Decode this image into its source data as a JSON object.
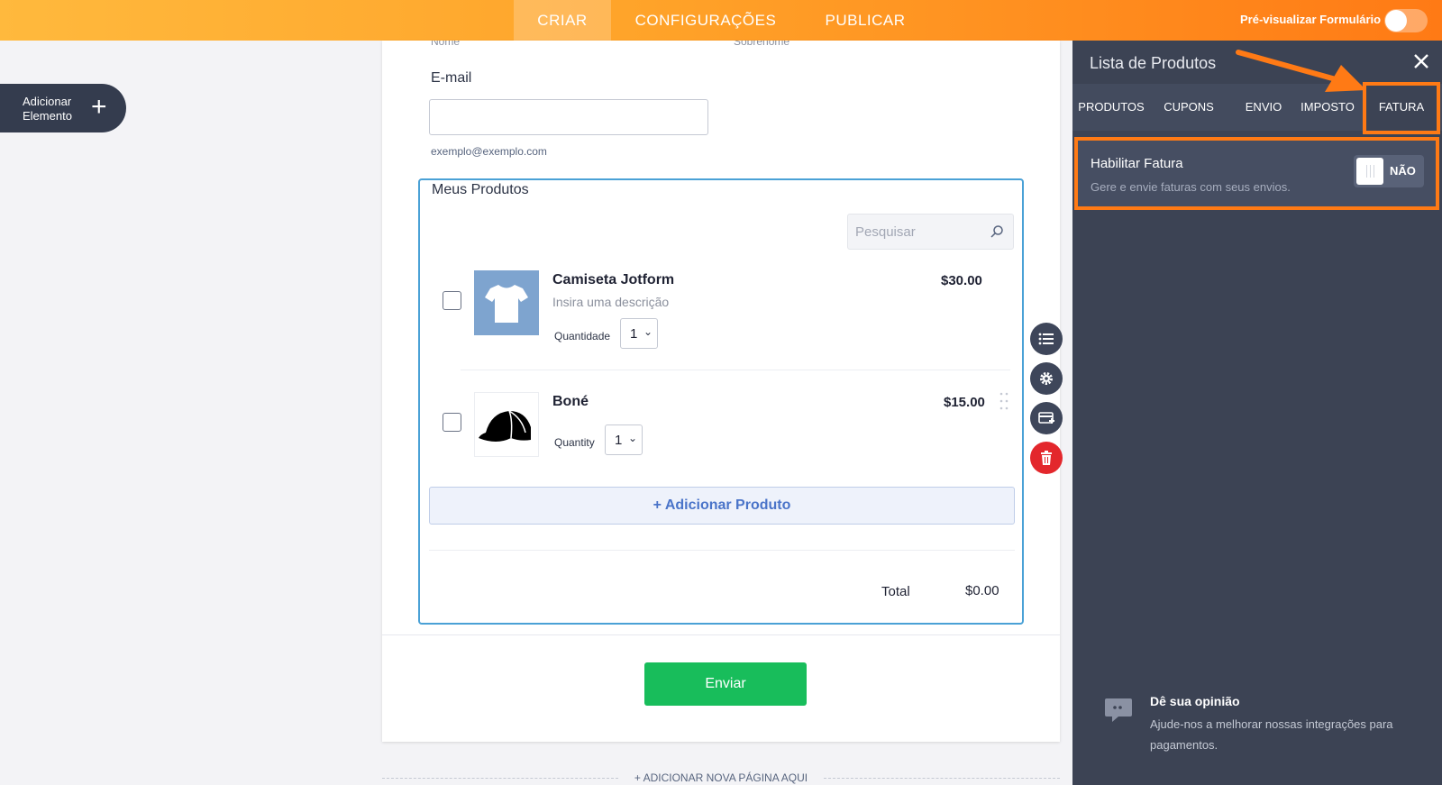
{
  "topbar": {
    "tabs": [
      {
        "label": "CRIAR",
        "active": true
      },
      {
        "label": "CONFIGURAÇÕES",
        "active": false
      },
      {
        "label": "PUBLICAR",
        "active": false
      }
    ],
    "preview_label": "Pré-visualizar Formulário",
    "preview_on": false
  },
  "sidebar": {
    "add_element_label": "Adicionar Elemento"
  },
  "form": {
    "cut_labels": {
      "first": "Nome",
      "last": "Sobrenome"
    },
    "email": {
      "label": "E-mail",
      "value": "",
      "sublabel": "exemplo@exemplo.com"
    },
    "products": {
      "title": "Meus Produtos",
      "search_placeholder": "Pesquisar",
      "items": [
        {
          "name": "Camiseta Jotform",
          "description": "Insira uma descrição",
          "price": "$30.00",
          "quantity_label": "Quantidade",
          "quantity": "1",
          "image": "tshirt-icon",
          "checked": false
        },
        {
          "name": "Boné",
          "description": "",
          "price": "$15.00",
          "quantity_label": "Quantity",
          "quantity": "1",
          "image": "cap-icon",
          "checked": false
        }
      ],
      "add_product_label": "+ Adicionar Produto",
      "total_label": "Total",
      "total_value": "$0.00"
    },
    "submit_label": "Enviar",
    "add_page_label": "+ ADICIONAR NOVA PÁGINA AQUI"
  },
  "panel": {
    "title": "Lista de Produtos",
    "tabs": [
      "PRODUTOS",
      "CUPONS",
      "ENVIO",
      "IMPOSTO",
      "FATURA"
    ],
    "active_tab": "FATURA",
    "setting": {
      "title": "Habilitar Fatura",
      "description": "Gere e envie faturas com seus envios.",
      "toggle_label": "NÃO",
      "enabled": false
    },
    "feedback": {
      "title": "Dê sua opinião",
      "description": "Ajude-nos a melhorar nossas integrações para pagamentos."
    }
  },
  "colors": {
    "accent": "#ff7a15",
    "submit": "#18bd5b",
    "panel": "#3c4354",
    "highlight": "#ff7a15",
    "delete": "#e3272c"
  }
}
